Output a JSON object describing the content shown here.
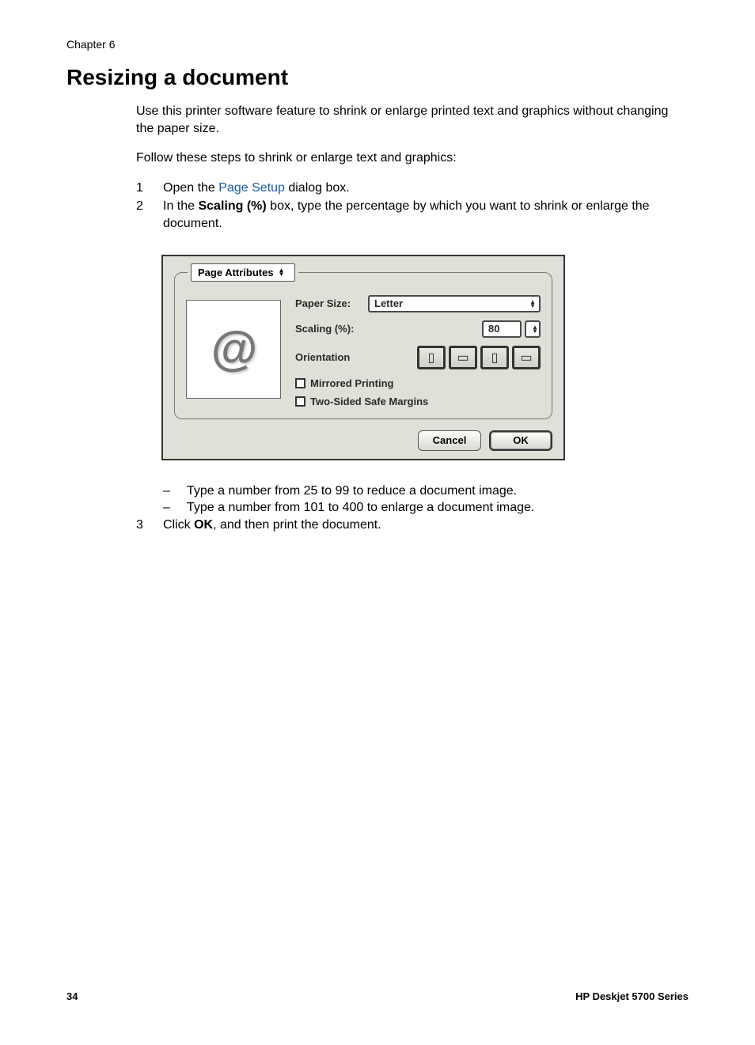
{
  "header": {
    "chapter": "Chapter 6"
  },
  "heading": "Resizing a document",
  "intro": {
    "p1": "Use this printer software feature to shrink or enlarge printed text and graphics without changing the paper size.",
    "p2": "Follow these steps to shrink or enlarge text and graphics:"
  },
  "steps": {
    "n1": "1",
    "s1a": "Open the ",
    "s1link": "Page Setup",
    "s1b": " dialog box.",
    "n2": "2",
    "s2a": "In the ",
    "s2bold": "Scaling (%)",
    "s2b": " box, type the percentage by which you want to shrink or enlarge the document.",
    "sub1": "Type a number from 25 to 99 to reduce a document image.",
    "sub2": "Type a number from 101 to 400 to enlarge a document image.",
    "dash": "–",
    "n3": "3",
    "s3a": "Click ",
    "s3bold": "OK",
    "s3b": ", and then print the document."
  },
  "dialog": {
    "tab": "Page Attributes",
    "paperSizeLabel": "Paper Size:",
    "paperSizeValue": "Letter",
    "scalingLabel": "Scaling (%):",
    "scalingValue": "80",
    "orientationLabel": "Orientation",
    "mirrored": "Mirrored Printing",
    "twosided": "Two-Sided Safe Margins",
    "cancel": "Cancel",
    "ok": "OK",
    "atGlyph": "@"
  },
  "footer": {
    "page": "34",
    "product": "HP Deskjet 5700 Series"
  }
}
